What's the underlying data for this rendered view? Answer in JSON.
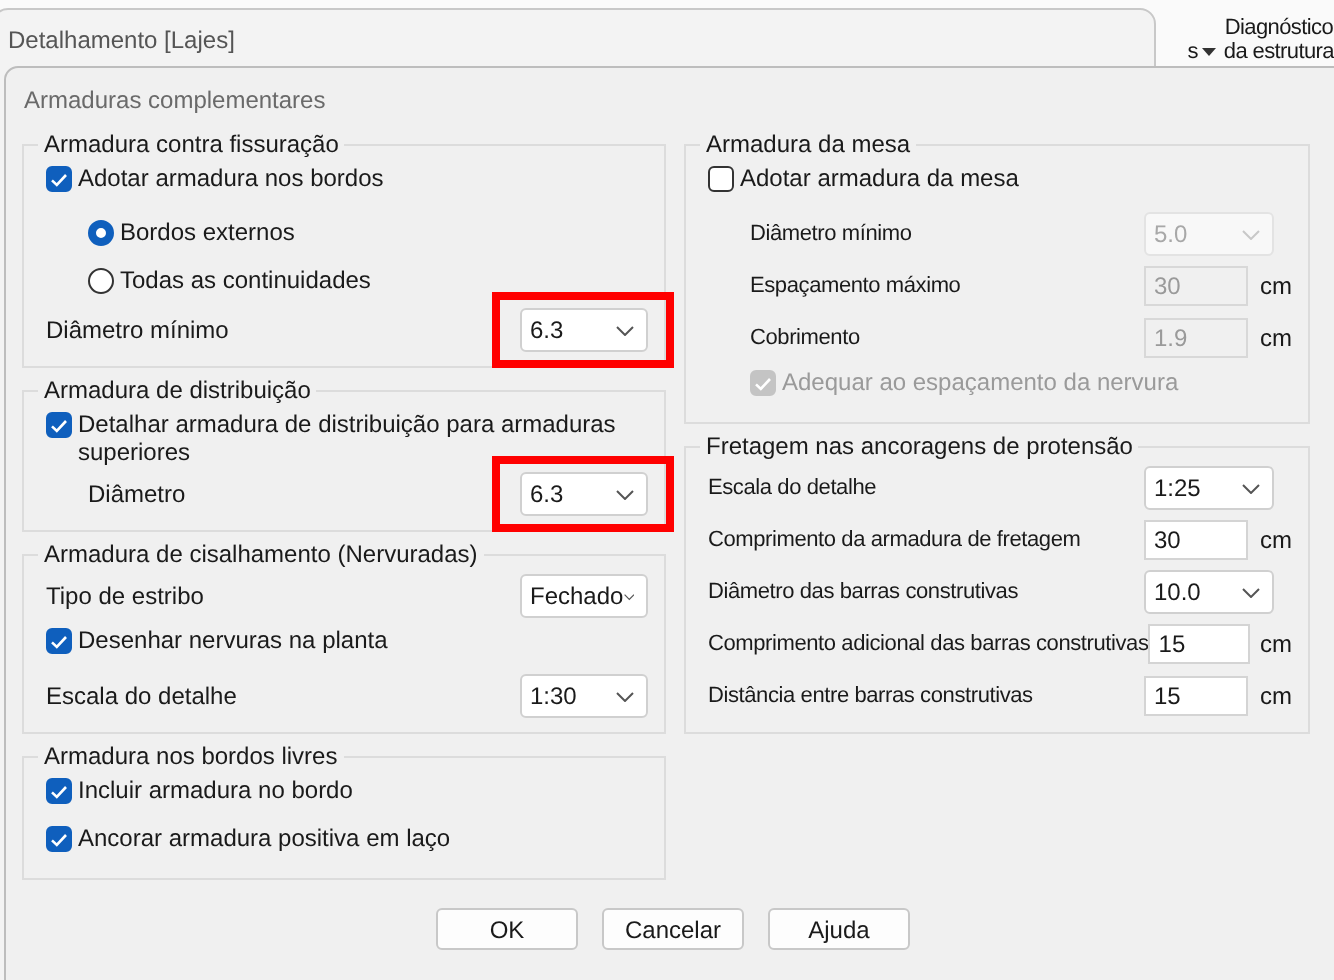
{
  "background_ribbon": {
    "items": [
      {
        "lines": [
          "s"
        ],
        "has_caret": true
      },
      {
        "lines": [
          "Diagnóstico",
          "da estrutura"
        ],
        "has_caret": false
      }
    ]
  },
  "back_window": {
    "title": "Detalhamento [Lajes]"
  },
  "window": {
    "title": "Armaduras complementares"
  },
  "left_groups": [
    {
      "title": "Armadura contra fissuração",
      "rows": [
        {
          "kind": "checkbox",
          "label": "Adotar armadura nos bordos",
          "checked": true,
          "disabled": false,
          "children": [
            {
              "kind": "radio",
              "label": "Bordos externos",
              "selected": true,
              "disabled": false
            },
            {
              "kind": "radio",
              "label": "Todas as continuidades",
              "selected": false,
              "disabled": false
            }
          ]
        },
        {
          "kind": "select",
          "label": "Diâmetro mínimo",
          "value": "6.3",
          "disabled": false,
          "highlighted": true
        }
      ]
    },
    {
      "title": "Armadura de distribuição",
      "rows": [
        {
          "kind": "checkbox",
          "label": "Detalhar armadura de distribuição para armaduras superiores",
          "checked": true,
          "disabled": false,
          "children": [
            {
              "kind": "select",
              "label": "Diâmetro",
              "value": "6.3",
              "disabled": false,
              "highlighted": true
            }
          ]
        }
      ]
    },
    {
      "title": "Armadura de cisalhamento (Nervuradas)",
      "rows": [
        {
          "kind": "select",
          "label": "Tipo de estribo",
          "value": "Fechado",
          "disabled": false,
          "highlighted": false
        },
        {
          "kind": "checkbox",
          "label": "Desenhar nervuras na planta",
          "checked": true,
          "disabled": false
        },
        {
          "kind": "select",
          "label": "Escala do detalhe",
          "value": "1:30",
          "disabled": false,
          "highlighted": false
        }
      ]
    },
    {
      "title": "Armadura nos bordos livres",
      "rows": [
        {
          "kind": "checkbox",
          "label": "Incluir armadura no bordo",
          "checked": true,
          "disabled": false
        },
        {
          "kind": "checkbox",
          "label": "Ancorar armadura positiva em laço",
          "checked": true,
          "disabled": false
        }
      ]
    }
  ],
  "right_groups": [
    {
      "title": "Armadura da mesa",
      "rows": [
        {
          "kind": "checkbox",
          "label": "Adotar armadura da mesa",
          "checked": false,
          "disabled": false,
          "children": [
            {
              "kind": "select",
              "label": "Diâmetro mínimo",
              "value": "5.0",
              "disabled": true,
              "highlighted": false
            },
            {
              "kind": "input",
              "label": "Espaçamento máximo",
              "value": "30",
              "unit": "cm",
              "disabled": true
            },
            {
              "kind": "input",
              "label": "Cobrimento",
              "value": "1.9",
              "unit": "cm",
              "disabled": true
            },
            {
              "kind": "checkbox",
              "label": "Adequar ao espaçamento da nervura",
              "checked": true,
              "disabled": true
            }
          ]
        }
      ]
    },
    {
      "title": "Fretagem nas ancoragens de protensão",
      "rows": [
        {
          "kind": "select",
          "label": "Escala do detalhe",
          "value": "1:25",
          "disabled": false,
          "highlighted": false
        },
        {
          "kind": "input",
          "label": "Comprimento da armadura de fretagem",
          "value": "30",
          "unit": "cm",
          "disabled": false
        },
        {
          "kind": "select",
          "label": "Diâmetro das barras construtivas",
          "value": "10.0",
          "disabled": false,
          "highlighted": false
        },
        {
          "kind": "input",
          "label": "Comprimento adicional das barras construtivas",
          "value": "15",
          "unit": "cm",
          "disabled": false
        },
        {
          "kind": "input",
          "label": "Distância entre barras construtivas",
          "value": "15",
          "unit": "cm",
          "disabled": false
        }
      ]
    }
  ],
  "buttons": [
    "OK",
    "Cancelar",
    "Ajuda"
  ]
}
